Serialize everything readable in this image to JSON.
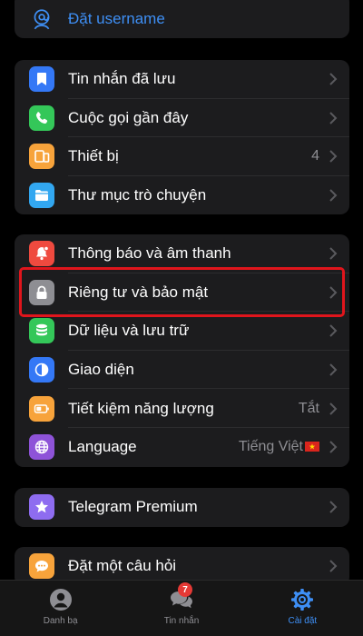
{
  "account": {
    "username_label": "Đặt username"
  },
  "group1": [
    {
      "label": "Tin nhắn đã lưu",
      "icon": "bookmark-icon",
      "color": "#3478f6"
    },
    {
      "label": "Cuộc gọi gần đây",
      "icon": "phone-icon",
      "color": "#34c759"
    },
    {
      "label": "Thiết bị",
      "value": "4",
      "icon": "devices-icon",
      "color": "#f7a33b"
    },
    {
      "label": "Thư mục trò chuyện",
      "icon": "folder-icon",
      "color": "#32a7f0"
    }
  ],
  "group2": [
    {
      "label": "Thông báo và âm thanh",
      "icon": "bell-icon",
      "color": "#ef4a3f"
    },
    {
      "label": "Riêng tư và bảo mật",
      "icon": "lock-icon",
      "color": "#8e8e93"
    },
    {
      "label": "Dữ liệu và lưu trữ",
      "icon": "database-icon",
      "color": "#34c759"
    },
    {
      "label": "Giao diện",
      "icon": "appearance-icon",
      "color": "#3478f6"
    },
    {
      "label": "Tiết kiệm năng lượng",
      "value": "Tắt",
      "icon": "battery-icon",
      "color": "#f7a33b"
    },
    {
      "label": "Language",
      "value": "Tiếng Việt",
      "icon": "globe-icon",
      "color": "#8e53d8"
    }
  ],
  "group3": [
    {
      "label": "Telegram Premium",
      "icon": "star-icon",
      "color": "#8e6cf0"
    }
  ],
  "group4": [
    {
      "label": "Đặt một câu hỏi",
      "icon": "chat-bubble-icon",
      "color": "#f7a33b"
    }
  ],
  "tabs": [
    {
      "label": "Danh bạ",
      "icon": "contacts-icon"
    },
    {
      "label": "Tin nhắn",
      "icon": "chats-icon",
      "badge": "7"
    },
    {
      "label": "Cài đặt",
      "icon": "settings-gear-icon",
      "active": true
    }
  ],
  "colors": {
    "accent": "#3e8ff5",
    "highlight_border": "#e0151c",
    "badge": "#e53935"
  }
}
